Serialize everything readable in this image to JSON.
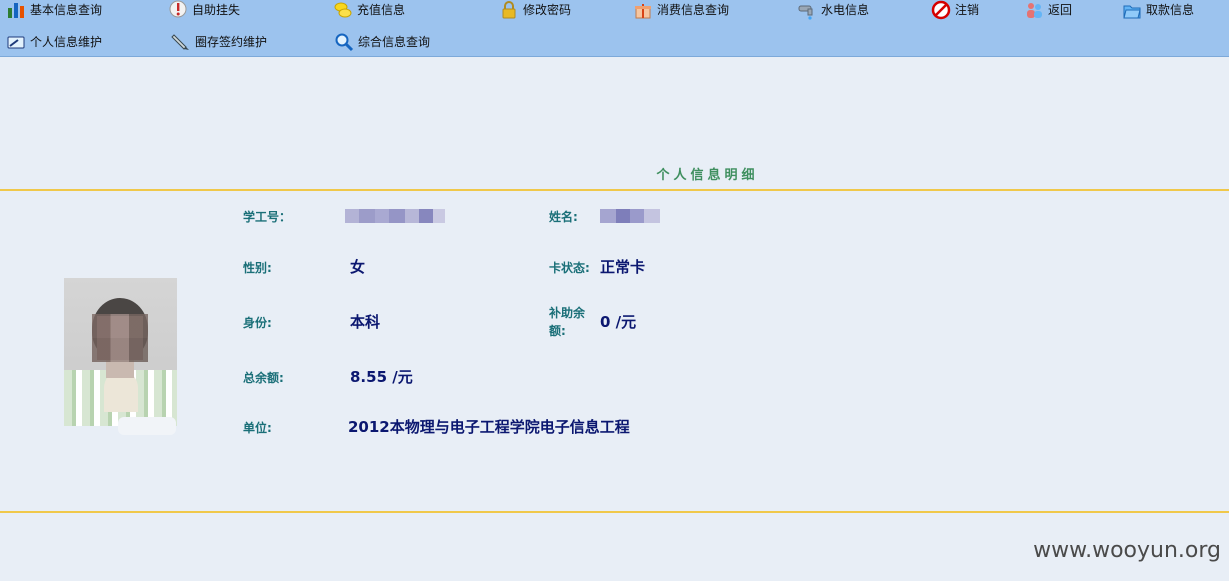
{
  "toolbar": {
    "row1": [
      {
        "label": "基本信息查询",
        "icon": "bar-chart-icon"
      },
      {
        "label": "自助挂失",
        "icon": "alert-icon"
      },
      {
        "label": "充值信息",
        "icon": "coins-icon"
      },
      {
        "label": "修改密码",
        "icon": "lock-icon"
      },
      {
        "label": "消费信息查询",
        "icon": "gift-box-icon"
      },
      {
        "label": "水电信息",
        "icon": "faucet-icon"
      },
      {
        "label": "注销",
        "icon": "no-entry-icon"
      },
      {
        "label": "返回",
        "icon": "users-icon"
      },
      {
        "label": "取款信息",
        "icon": "folder-icon"
      }
    ],
    "row2": [
      {
        "label": "个人信息维护",
        "icon": "card-edit-icon"
      },
      {
        "label": "圈存签约维护",
        "icon": "pen-icon"
      },
      {
        "label": "综合信息查询",
        "icon": "magnifier-icon"
      }
    ]
  },
  "section": {
    "title": "个人信息明细"
  },
  "fields": {
    "student_id_label": "学工号：",
    "name_label": "姓名:",
    "gender_label": "性别:",
    "gender_value": "女",
    "card_status_label": "卡状态:",
    "card_status_value": "正常卡",
    "identity_label": "身份:",
    "identity_value": "本科",
    "subsidy_label": "补助余额:",
    "subsidy_value": "0 /元",
    "total_balance_label": "总余额:",
    "total_balance_value": "8.55 /元",
    "unit_label": "单位:",
    "unit_value": "2012本物理与电子工程学院电子信息工程"
  },
  "watermark": "www.wooyun.org",
  "colors": {
    "toolbar_bg": "#9cc3ee",
    "page_bg": "#e8eef6",
    "divider": "#f0c84a",
    "title": "#3f8f5f",
    "label": "#1a6f78",
    "value": "#0b1770"
  }
}
